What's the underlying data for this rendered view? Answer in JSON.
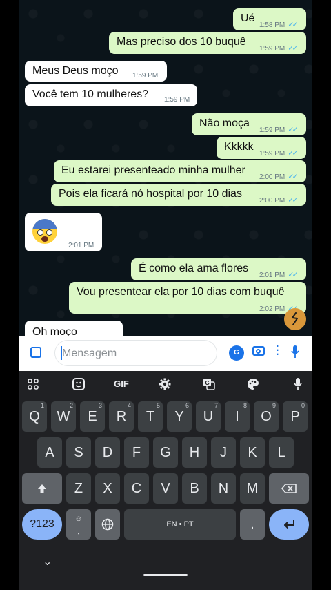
{
  "messages": [
    {
      "dir": "out",
      "text": "Ué",
      "time": "1:58 PM"
    },
    {
      "dir": "out",
      "text": "Mas preciso dos 10 buquê",
      "time": "1:59 PM"
    },
    {
      "dir": "in",
      "text": "Meus Deus moço",
      "time": "1:59 PM"
    },
    {
      "dir": "in",
      "text": "Você tem 10 mulheres?",
      "time": "1:59 PM"
    },
    {
      "dir": "out",
      "text": "Não moça",
      "time": "1:59 PM"
    },
    {
      "dir": "out",
      "text": "Kkkkk",
      "time": "1:59 PM"
    },
    {
      "dir": "out",
      "text": "Eu estarei presenteado minha mulher",
      "time": "2:00 PM"
    },
    {
      "dir": "out",
      "text": "Pois ela ficará nó hospital por 10 dias",
      "time": "2:00 PM"
    },
    {
      "dir": "in",
      "text": "",
      "emoji": "fearful-face",
      "time": "2:01 PM"
    },
    {
      "dir": "out",
      "text": "É como ela ama flores",
      "time": "2:01 PM"
    },
    {
      "dir": "out",
      "text": "Vou presentear ela por 10 dias com buquê",
      "time": "2:02 PM"
    },
    {
      "dir": "in",
      "text": "Oh moço",
      "time": ""
    }
  ],
  "composer": {
    "placeholder": "Mensagem"
  },
  "keyboard": {
    "toolbar": {
      "gif": "GIF"
    },
    "row1": [
      {
        "k": "Q",
        "n": "1"
      },
      {
        "k": "W",
        "n": "2"
      },
      {
        "k": "E",
        "n": "3"
      },
      {
        "k": "R",
        "n": "4"
      },
      {
        "k": "T",
        "n": "5"
      },
      {
        "k": "Y",
        "n": "6"
      },
      {
        "k": "U",
        "n": "7"
      },
      {
        "k": "I",
        "n": "8"
      },
      {
        "k": "O",
        "n": "9"
      },
      {
        "k": "P",
        "n": "0"
      }
    ],
    "row2": [
      "A",
      "S",
      "D",
      "F",
      "G",
      "H",
      "J",
      "K",
      "L"
    ],
    "row3": [
      "Z",
      "X",
      "C",
      "V",
      "B",
      "N",
      "M"
    ],
    "symbols": "?123",
    "comma": ",",
    "space": "EN • PT",
    "period": "."
  },
  "colors": {
    "outgoing": "#dcf8c6",
    "incoming": "#ffffff",
    "read_tick": "#4fb6ec",
    "accent": "#1a73e8"
  }
}
